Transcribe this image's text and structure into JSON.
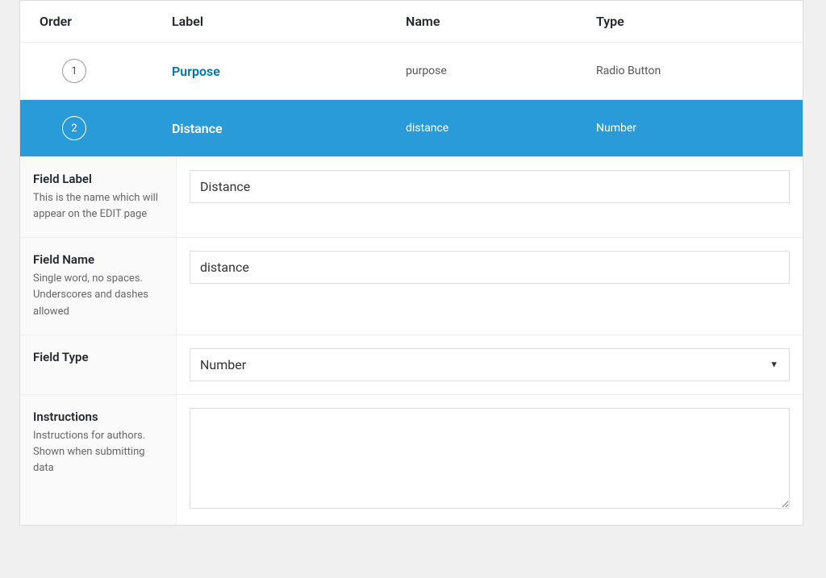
{
  "headers": {
    "order": "Order",
    "label": "Label",
    "name": "Name",
    "type": "Type"
  },
  "rows": [
    {
      "order": "1",
      "label": "Purpose",
      "name": "purpose",
      "type": "Radio Button",
      "active": false
    },
    {
      "order": "2",
      "label": "Distance",
      "name": "distance",
      "type": "Number",
      "active": true
    }
  ],
  "editor": {
    "field_label": {
      "title": "Field Label",
      "desc": "This is the name which will appear on the EDIT page",
      "value": "Distance"
    },
    "field_name": {
      "title": "Field Name",
      "desc": "Single word, no spaces. Underscores and dashes allowed",
      "value": "distance"
    },
    "field_type": {
      "title": "Field Type",
      "desc": "",
      "value": "Number"
    },
    "instructions": {
      "title": "Instructions",
      "desc": "Instructions for authors. Shown when submitting data",
      "value": ""
    }
  }
}
